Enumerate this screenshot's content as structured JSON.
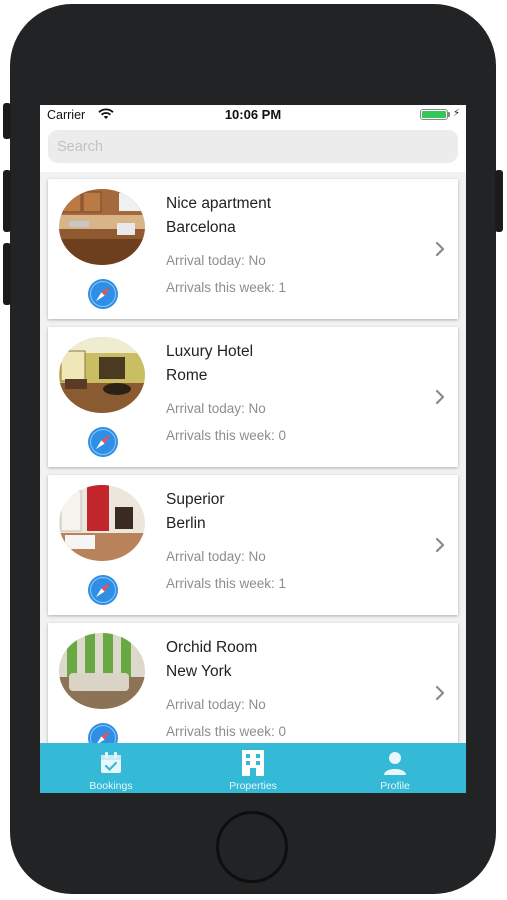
{
  "status_bar": {
    "carrier": "Carrier",
    "time": "10:06 PM"
  },
  "search": {
    "placeholder": "Search",
    "value": ""
  },
  "properties": [
    {
      "name": "Nice apartment",
      "city": "Barcelona",
      "arrival_today": "Arrival today: No",
      "arrivals_week": "Arrivals this week: 1"
    },
    {
      "name": "Luxury Hotel",
      "city": "Rome",
      "arrival_today": "Arrival today: No",
      "arrivals_week": "Arrivals this week: 0"
    },
    {
      "name": "Superior",
      "city": "Berlin",
      "arrival_today": "Arrival today: No",
      "arrivals_week": "Arrivals this week: 1"
    },
    {
      "name": "Orchid Room",
      "city": "New York",
      "arrival_today": "Arrival today: No",
      "arrivals_week": "Arrivals this week: 0"
    }
  ],
  "tabs": [
    {
      "label": "Bookings",
      "icon": "calendar-check-icon"
    },
    {
      "label": "Properties",
      "icon": "building-icon"
    },
    {
      "label": "Profile",
      "icon": "person-icon"
    }
  ],
  "colors": {
    "tab_bar": "#34b9d6",
    "accent": "#2f8fe6",
    "battery": "#34c759"
  }
}
